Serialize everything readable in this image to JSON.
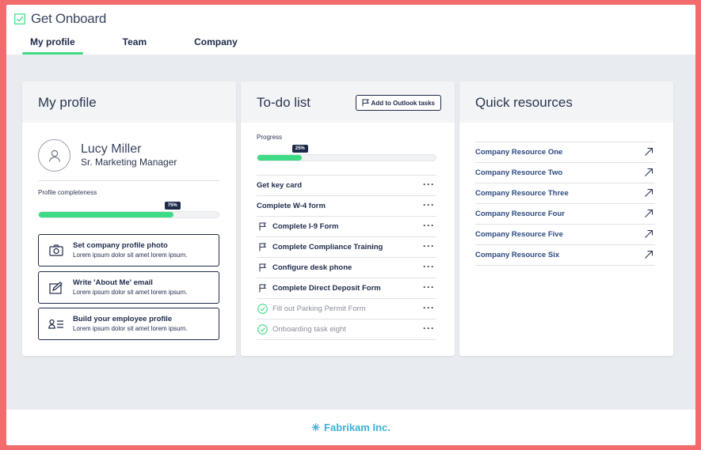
{
  "app": {
    "title": "Get Onboard"
  },
  "nav": {
    "tabs": [
      "My profile",
      "Team",
      "Company"
    ],
    "active": 0
  },
  "profile": {
    "heading": "My profile",
    "name": "Lucy Miller",
    "role": "Sr. Marketing Manager",
    "completeness_label": "Profile completeness",
    "completeness_text": "75%",
    "completeness": 0.75,
    "actions": [
      {
        "title": "Set company profile photo",
        "desc": "Lorem ipsum dolor sit amet lorem ipsum.",
        "icon": "camera-icon"
      },
      {
        "title": "Write 'About Me' email",
        "desc": "Lorem ipsum dolor sit amet lorem ipsum.",
        "icon": "edit-note-icon"
      },
      {
        "title": "Build your employee profile",
        "desc": "Lorem ipsum dolor sit amet lorem ipsum.",
        "icon": "contact-card-icon"
      }
    ]
  },
  "todo": {
    "heading": "To-do list",
    "outlook_button": "Add to Outlook tasks",
    "progress_label": "Progress",
    "progress_text": "25%",
    "progress": 0.25,
    "tasks": [
      {
        "label": "Get key card",
        "status": "plain"
      },
      {
        "label": "Complete W-4 form",
        "status": "plain"
      },
      {
        "label": "Complete I-9 Form",
        "status": "flagged"
      },
      {
        "label": "Complete Compliance Training",
        "status": "flagged"
      },
      {
        "label": "Configure desk phone",
        "status": "flagged"
      },
      {
        "label": "Complete Direct Deposit Form",
        "status": "flagged"
      },
      {
        "label": "Fill out Parking Permit Form",
        "status": "done"
      },
      {
        "label": "Onboarding task eight",
        "status": "done"
      }
    ],
    "more_symbol": "···"
  },
  "resources": {
    "heading": "Quick resources",
    "items": [
      "Company Resource One",
      "Company Resource Two",
      "Company Resource Three",
      "Company Resource Four",
      "Company Resource Five",
      "Company Resource Six"
    ]
  },
  "footer": {
    "brand": "Fabrikam Inc."
  },
  "colors": {
    "accent": "#3ddc84",
    "navy": "#1e2a4a",
    "link": "#2c4a7e",
    "footer_brand": "#3bb2d6",
    "frame": "#f26b6d"
  }
}
